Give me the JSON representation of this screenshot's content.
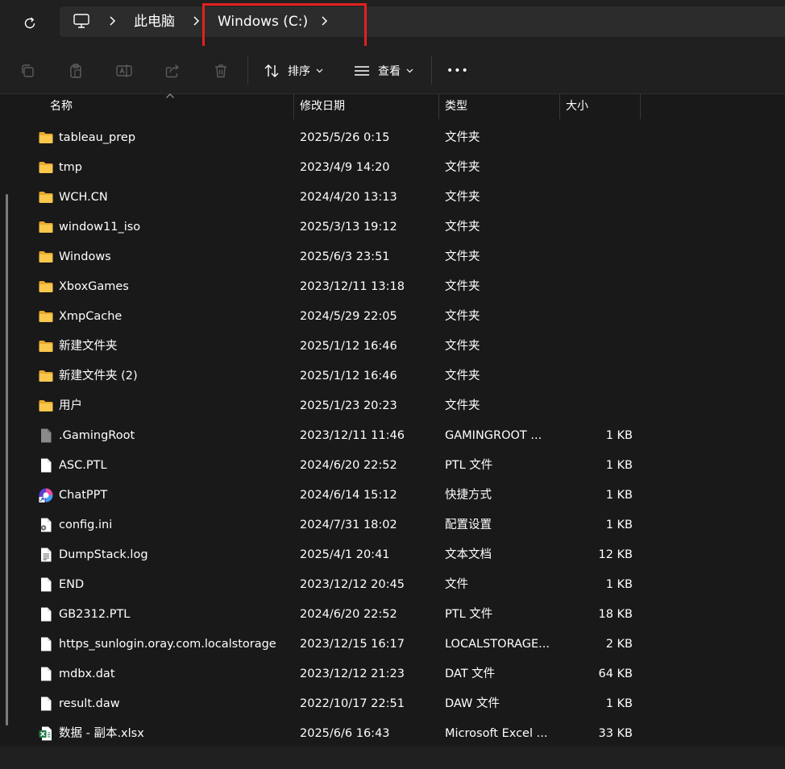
{
  "address_bar": {
    "crumbs": [
      "此电脑",
      "Windows (C:)"
    ]
  },
  "command_bar": {
    "sort_label": "排序",
    "view_label": "查看",
    "more_label": "•••"
  },
  "columns": {
    "name": "名称",
    "date": "修改日期",
    "type": "类型",
    "size": "大小"
  },
  "files": [
    {
      "name": "tableau_prep",
      "date": "2025/5/26 0:15",
      "type": "文件夹",
      "size": "",
      "icon": "folder-icon"
    },
    {
      "name": "tmp",
      "date": "2023/4/9 14:20",
      "type": "文件夹",
      "size": "",
      "icon": "folder-icon"
    },
    {
      "name": "WCH.CN",
      "date": "2024/4/20 13:13",
      "type": "文件夹",
      "size": "",
      "icon": "folder-icon"
    },
    {
      "name": "window11_iso",
      "date": "2025/3/13 19:12",
      "type": "文件夹",
      "size": "",
      "icon": "folder-icon"
    },
    {
      "name": "Windows",
      "date": "2025/6/3 23:51",
      "type": "文件夹",
      "size": "",
      "icon": "folder-icon"
    },
    {
      "name": "XboxGames",
      "date": "2023/12/11 13:18",
      "type": "文件夹",
      "size": "",
      "icon": "folder-icon"
    },
    {
      "name": "XmpCache",
      "date": "2024/5/29 22:05",
      "type": "文件夹",
      "size": "",
      "icon": "folder-icon"
    },
    {
      "name": "新建文件夹",
      "date": "2025/1/12 16:46",
      "type": "文件夹",
      "size": "",
      "icon": "folder-icon"
    },
    {
      "name": "新建文件夹 (2)",
      "date": "2025/1/12 16:46",
      "type": "文件夹",
      "size": "",
      "icon": "folder-icon"
    },
    {
      "name": "用户",
      "date": "2025/1/23 20:23",
      "type": "文件夹",
      "size": "",
      "icon": "folder-icon"
    },
    {
      "name": ".GamingRoot",
      "date": "2023/12/11 11:46",
      "type": "GAMINGROOT ...",
      "size": "1 KB",
      "icon": "system-file-icon"
    },
    {
      "name": "ASC.PTL",
      "date": "2024/6/20 22:52",
      "type": "PTL 文件",
      "size": "1 KB",
      "icon": "file-icon"
    },
    {
      "name": "ChatPPT",
      "date": "2024/6/14 15:12",
      "type": "快捷方式",
      "size": "1 KB",
      "icon": "shortcut-icon"
    },
    {
      "name": "config.ini",
      "date": "2024/7/31 18:02",
      "type": "配置设置",
      "size": "1 KB",
      "icon": "config-file-icon"
    },
    {
      "name": "DumpStack.log",
      "date": "2025/4/1 20:41",
      "type": "文本文档",
      "size": "12 KB",
      "icon": "text-file-icon"
    },
    {
      "name": "END",
      "date": "2023/12/12 20:45",
      "type": "文件",
      "size": "1 KB",
      "icon": "file-icon"
    },
    {
      "name": "GB2312.PTL",
      "date": "2024/6/20 22:52",
      "type": "PTL 文件",
      "size": "18 KB",
      "icon": "file-icon"
    },
    {
      "name": "https_sunlogin.oray.com.localstorage",
      "date": "2023/12/15 16:17",
      "type": "LOCALSTORAGE...",
      "size": "2 KB",
      "icon": "file-icon"
    },
    {
      "name": "mdbx.dat",
      "date": "2023/12/12 21:23",
      "type": "DAT 文件",
      "size": "64 KB",
      "icon": "file-icon"
    },
    {
      "name": "result.daw",
      "date": "2022/10/17 22:51",
      "type": "DAW 文件",
      "size": "1 KB",
      "icon": "file-icon"
    },
    {
      "name": "数据 - 副本.xlsx",
      "date": "2025/6/6 16:43",
      "type": "Microsoft Excel ...",
      "size": "33 KB",
      "icon": "excel-file-icon"
    }
  ]
}
